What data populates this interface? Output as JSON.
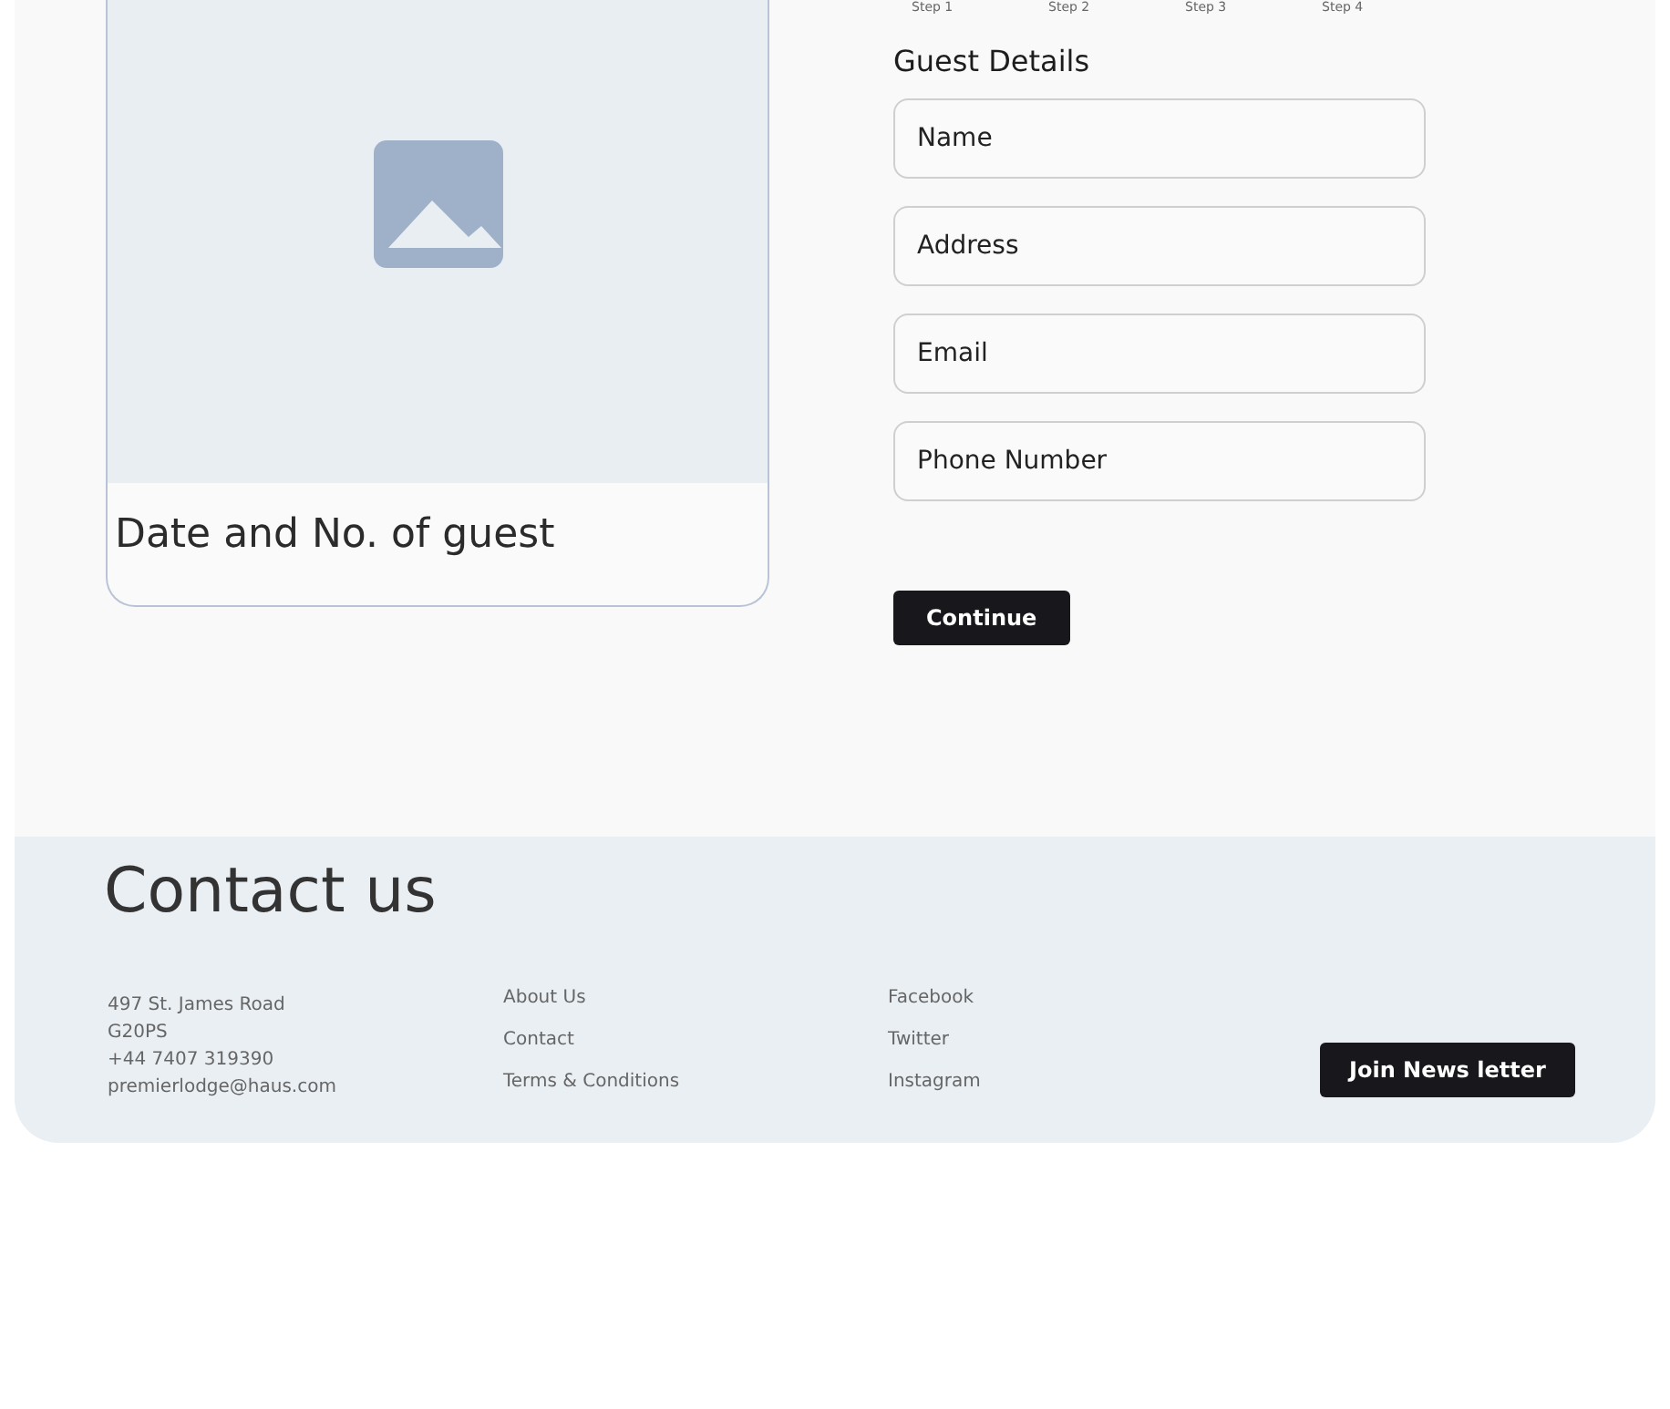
{
  "image_card": {
    "title": "Date and No. of guest"
  },
  "steps": [
    {
      "label": "Step 1"
    },
    {
      "label": "Step 2"
    },
    {
      "label": "Step 3"
    },
    {
      "label": "Step 4"
    }
  ],
  "form": {
    "heading": "Guest Details",
    "fields": [
      {
        "placeholder": "Name"
      },
      {
        "placeholder": "Address"
      },
      {
        "placeholder": "Email"
      },
      {
        "placeholder": "Phone Number"
      }
    ],
    "button": "Continue"
  },
  "footer": {
    "title": "Contact us",
    "address": [
      "497 St. James Road",
      "G20PS",
      "+44 7407 319390",
      "premierlodge@haus.com"
    ],
    "links": [
      "About Us",
      "Contact",
      "Terms & Conditions"
    ],
    "social": [
      "Facebook",
      "Twitter",
      "Instagram"
    ],
    "button": "Join News letter"
  }
}
